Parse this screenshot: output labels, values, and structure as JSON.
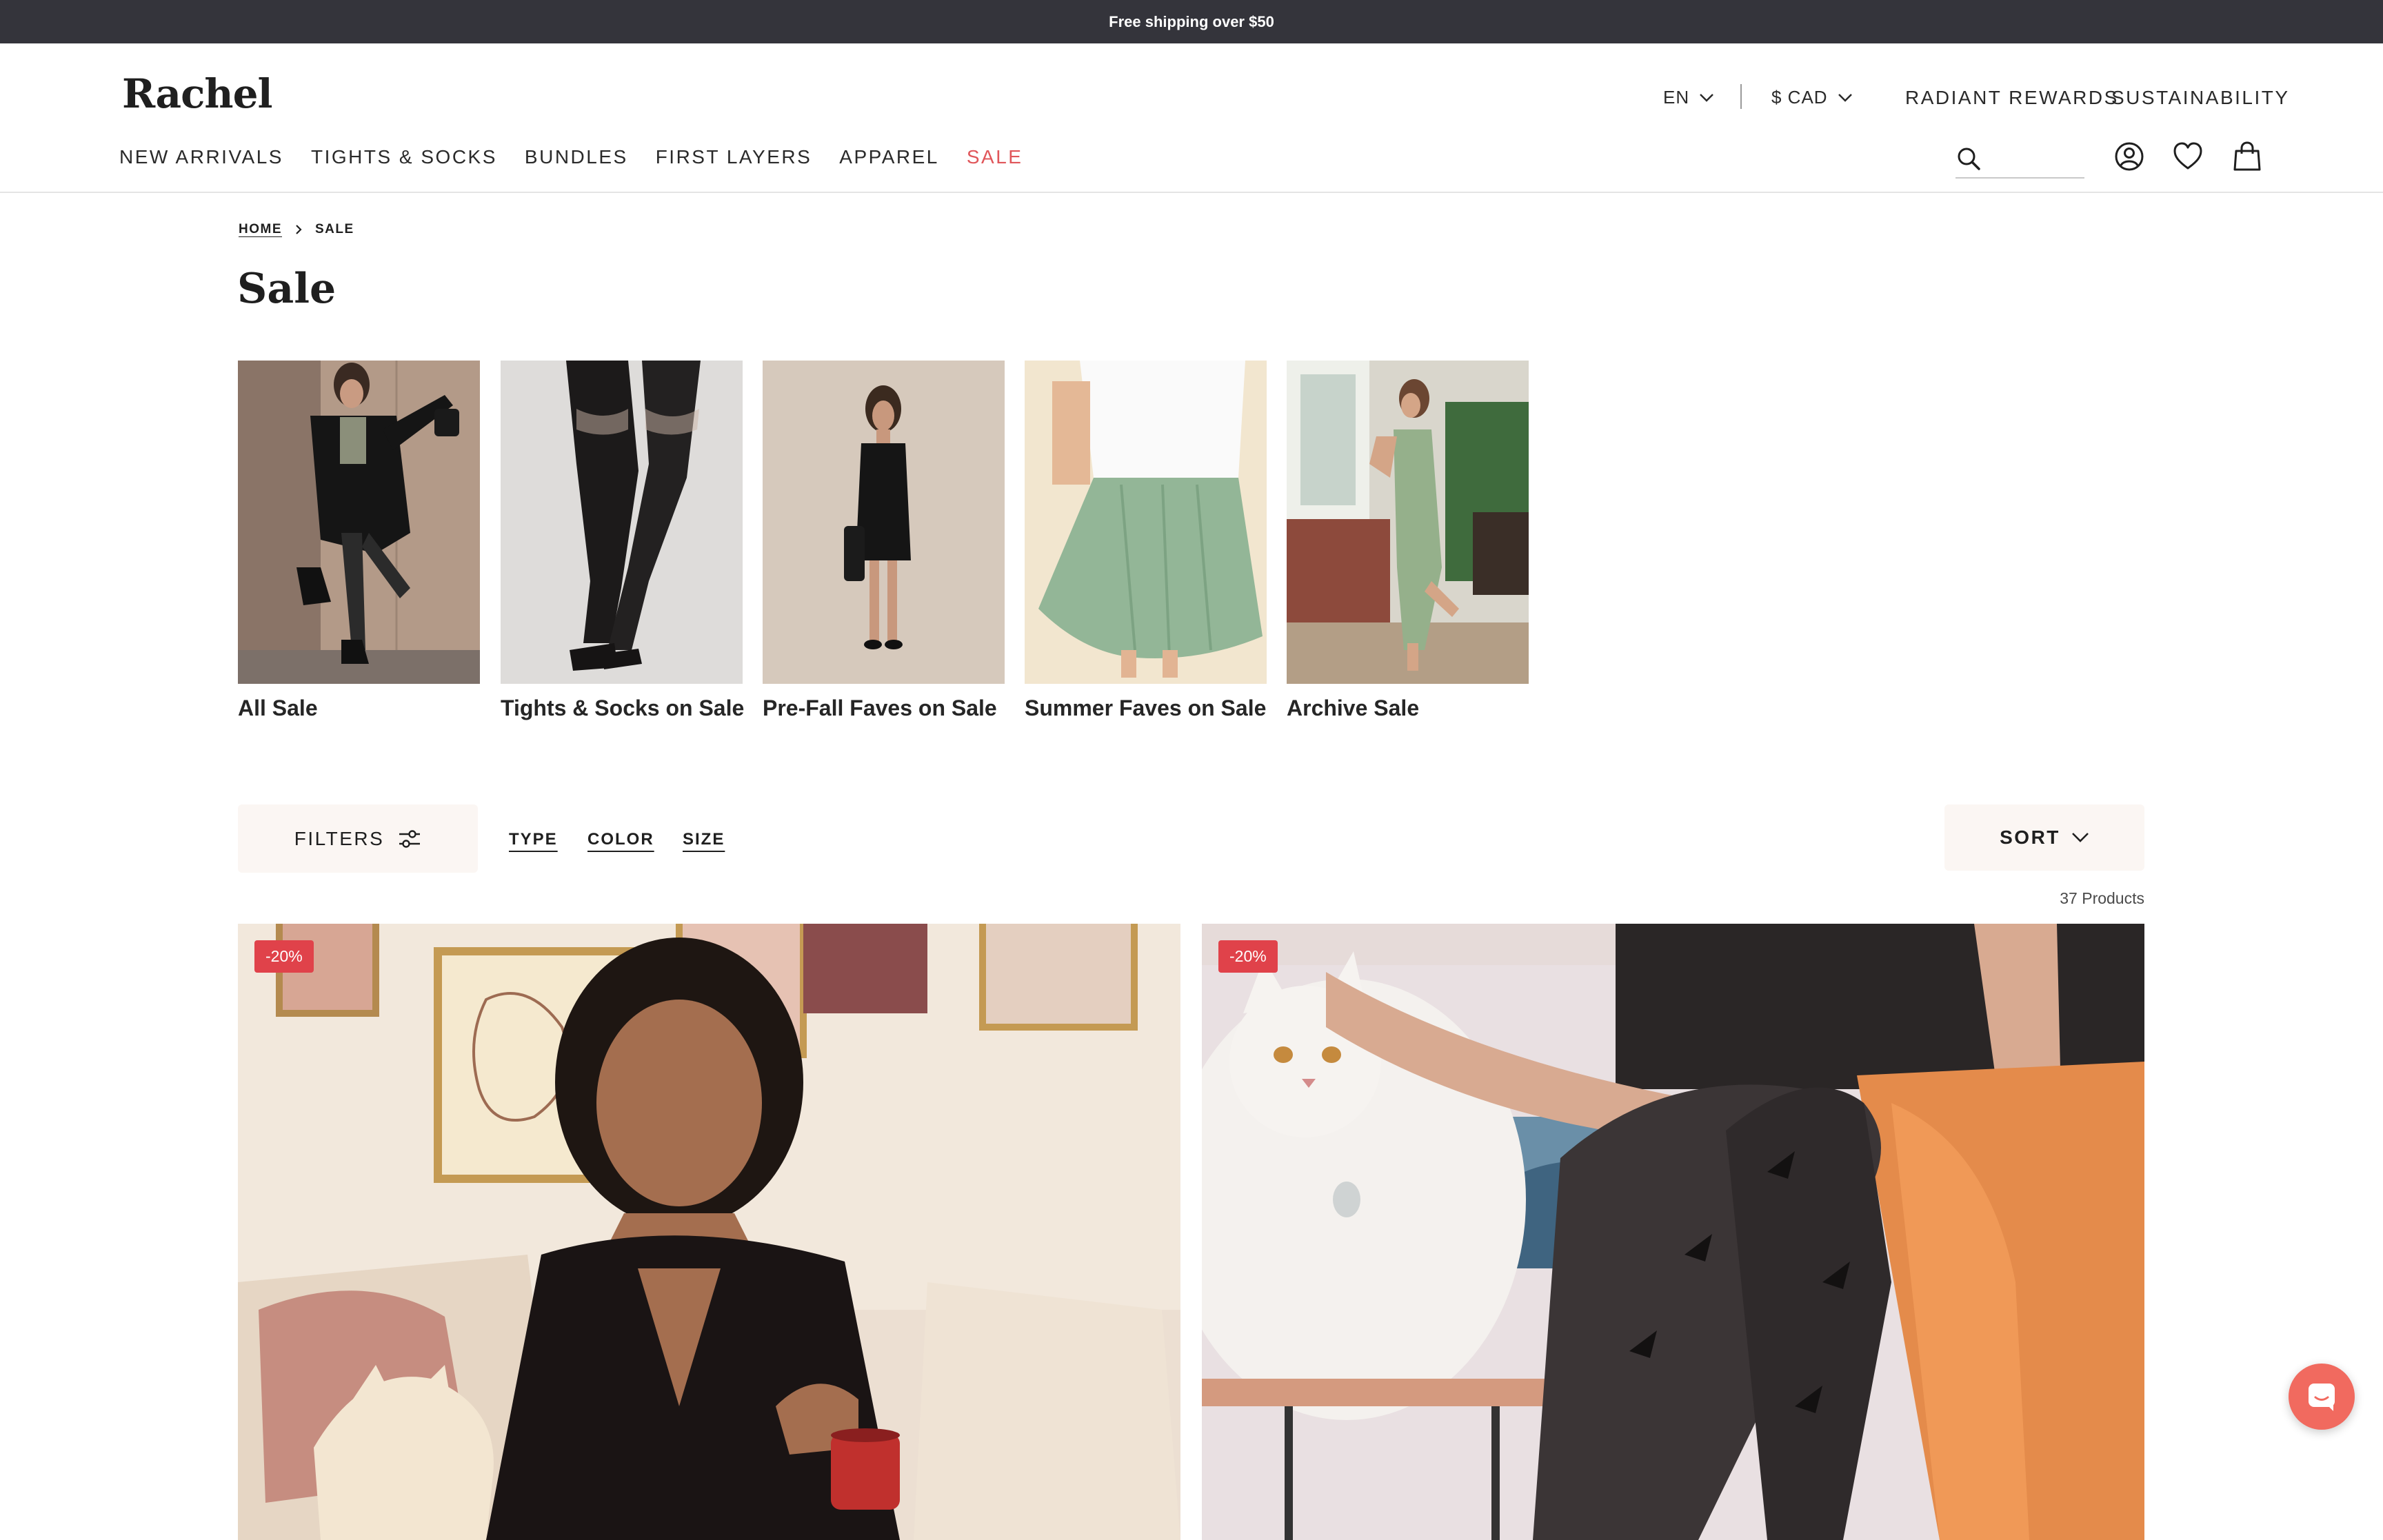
{
  "announcement": "Free shipping over $50",
  "brand": {
    "logo": "Rachel"
  },
  "utility": {
    "language": "EN",
    "currency": "$ CAD",
    "links": [
      "RADIANT REWARDS",
      "SUSTAINABILITY"
    ]
  },
  "nav": {
    "items": [
      "NEW ARRIVALS",
      "TIGHTS & SOCKS",
      "BUNDLES",
      "FIRST LAYERS",
      "APPAREL",
      "SALE"
    ]
  },
  "search": {
    "placeholder": ""
  },
  "icons": {
    "search": "search-icon",
    "account": "account-icon",
    "wishlist": "heart-icon",
    "cart": "shopping-bag-icon",
    "chat": "chat-icon"
  },
  "breadcrumb": {
    "home": "HOME",
    "current": "SALE"
  },
  "page": {
    "title": "Sale"
  },
  "categories": [
    {
      "label": "All Sale"
    },
    {
      "label": "Tights & Socks on Sale"
    },
    {
      "label": "Pre-Fall Faves on Sale"
    },
    {
      "label": "Summer Faves on Sale"
    },
    {
      "label": "Archive Sale"
    }
  ],
  "filters": {
    "button": "FILTERS",
    "tabs": [
      "TYPE",
      "COLOR",
      "SIZE"
    ],
    "sort": "SORT",
    "count": "37 Products"
  },
  "products": [
    {
      "badge": "-20%"
    },
    {
      "badge": "-20%"
    }
  ],
  "colors": {
    "announcement_bg": "#34343b",
    "sale_accent": "#e0565a",
    "badge": "#e0424a",
    "filter_bg": "#fbf6f3",
    "chat": "#f16a5f"
  }
}
